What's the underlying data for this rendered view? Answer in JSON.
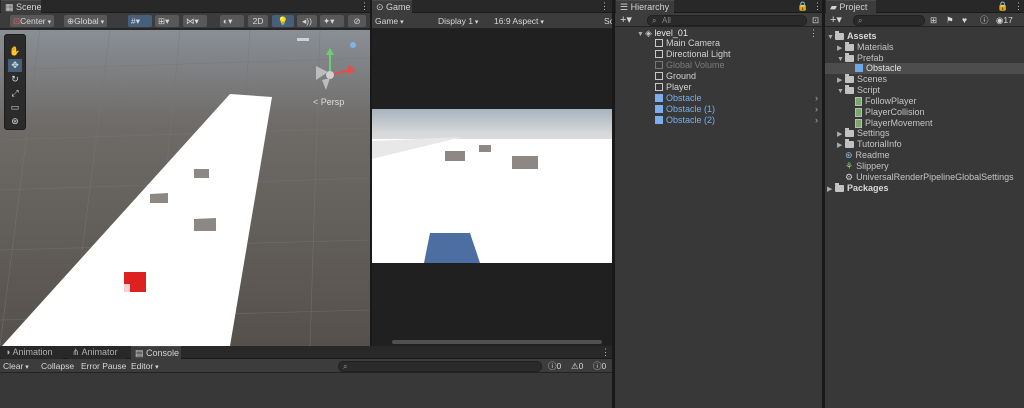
{
  "scene": {
    "tab_label": "Scene",
    "pivot_mode": "Center",
    "pivot_rotation": "Global",
    "mode_2d": "2D",
    "persp_label": "< Persp",
    "tools": [
      "hand-tool-icon",
      "move-tool-icon",
      "rotate-tool-icon",
      "scale-tool-icon",
      "rect-tool-icon",
      "transform-tool-icon"
    ]
  },
  "game": {
    "tab_label": "Game",
    "view_select": "Game",
    "display": "Display 1",
    "aspect": "16:9 Aspect",
    "truncated_label": "Sc"
  },
  "hierarchy": {
    "tab_label": "Hierarchy",
    "search_placeholder": "All",
    "scene_name": "level_01",
    "items": [
      {
        "label": "Main Camera",
        "state": "normal"
      },
      {
        "label": "Directional Light",
        "state": "normal"
      },
      {
        "label": "Global Volume",
        "state": "disabled"
      },
      {
        "label": "Ground",
        "state": "normal"
      },
      {
        "label": "Player",
        "state": "normal"
      },
      {
        "label": "Obstacle",
        "state": "prefab"
      },
      {
        "label": "Obstacle (1)",
        "state": "prefab"
      },
      {
        "label": "Obstacle (2)",
        "state": "prefab"
      }
    ]
  },
  "project": {
    "tab_label": "Project",
    "badge_count": "17",
    "assets_label": "Assets",
    "materials_label": "Materials",
    "prefab_label": "Prefab",
    "obstacle_label": "Obstacle",
    "scenes_label": "Scenes",
    "script_label": "Script",
    "script_files": [
      "FollowPlayer",
      "PlayerCollision",
      "PlayerMovement"
    ],
    "settings_label": "Settings",
    "tutorial_label": "TutorialInfo",
    "readme_label": "Readme",
    "slippery_label": "Slippery",
    "urp_settings_label": "UniversalRenderPipelineGlobalSettings",
    "packages_label": "Packages"
  },
  "console": {
    "tabs": [
      "Animation",
      "Animator",
      "Console"
    ],
    "clear_label": "Clear",
    "collapse_label": "Collapse",
    "error_pause_label": "Error Pause",
    "editor_label": "Editor",
    "log_count": "0",
    "warning_count": "0",
    "error_count": "0"
  },
  "colors": {
    "prefab_blue": "#7aaeed",
    "selection": "#46607c",
    "panel_bg": "#383838",
    "tab_bg": "#282828"
  }
}
